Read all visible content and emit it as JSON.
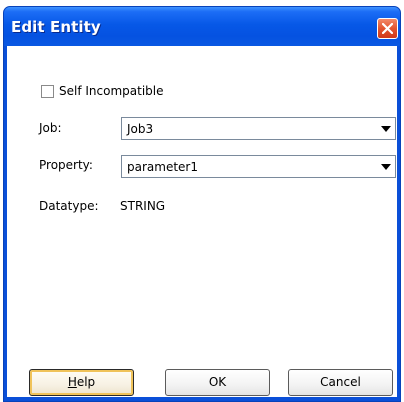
{
  "dialog": {
    "title": "Edit Entity",
    "close_icon": "close-x-icon",
    "colors": {
      "titlebar": "#0758e7",
      "close_button": "#e2542f",
      "client": "#ffffff"
    }
  },
  "form": {
    "self_incompatible": {
      "label": "Self Incompatible",
      "checked": false
    },
    "job": {
      "label": "Job:",
      "value": "Job3"
    },
    "property": {
      "label": "Property:",
      "value": "parameter1"
    },
    "datatype": {
      "label": "Datatype:",
      "value": "STRING"
    }
  },
  "buttons": {
    "help_mnemonic": "H",
    "help_rest": "elp",
    "ok": "OK",
    "cancel": "Cancel"
  }
}
